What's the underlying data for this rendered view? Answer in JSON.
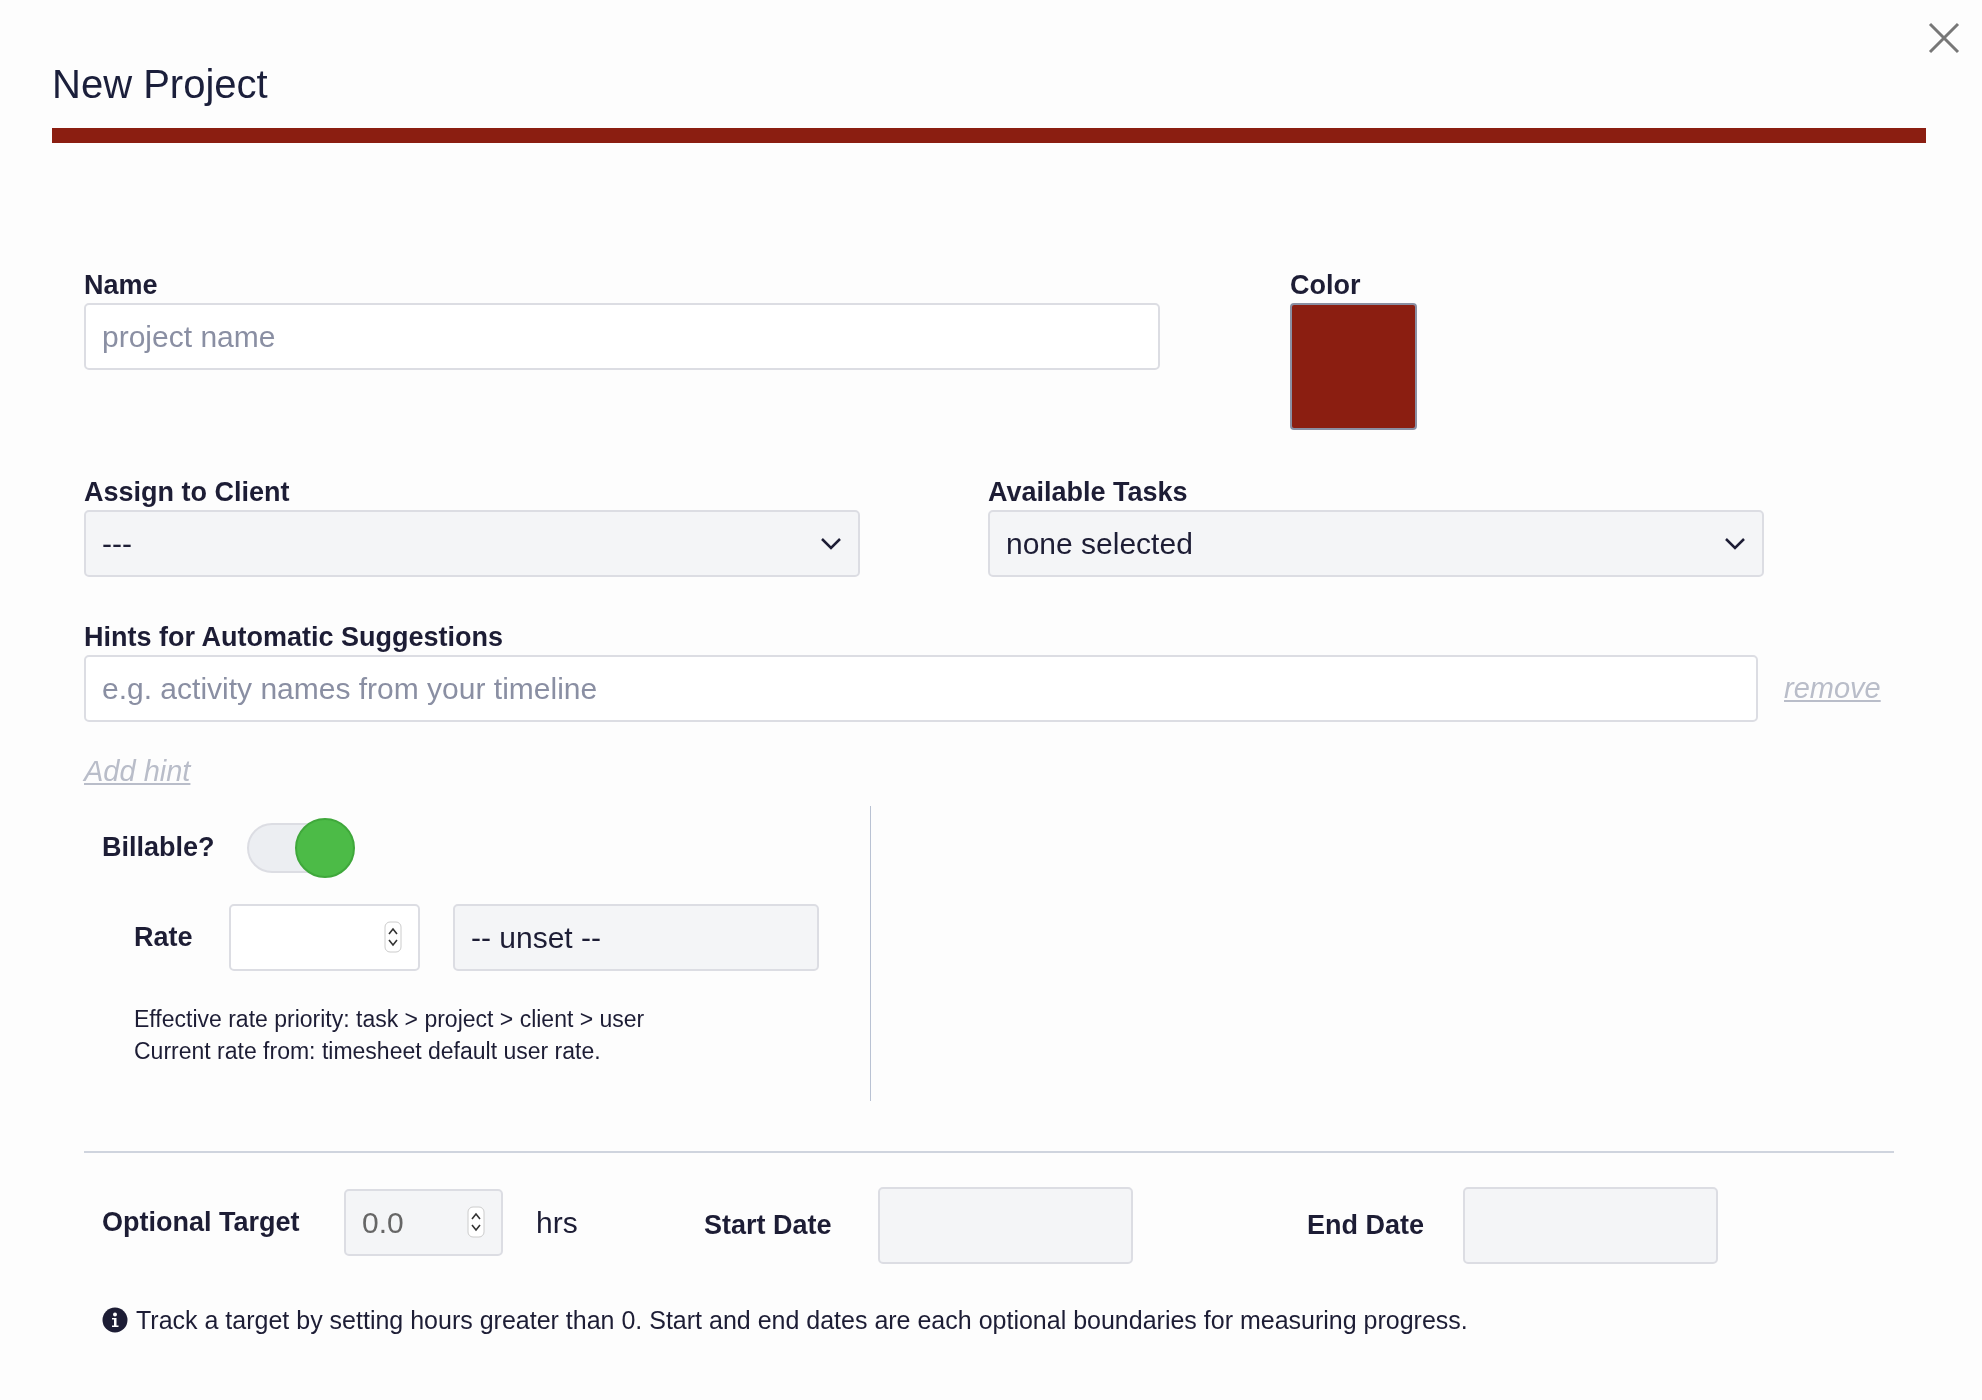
{
  "dialog": {
    "title": "New Project"
  },
  "name_field": {
    "label": "Name",
    "placeholder": "project name"
  },
  "color_field": {
    "label": "Color",
    "color": "#8b1e11"
  },
  "client_select": {
    "label": "Assign to Client",
    "value": "---"
  },
  "tasks_select": {
    "label": "Available Tasks",
    "value": "none selected"
  },
  "hints": {
    "label": "Hints for Automatic Suggestions",
    "placeholder": "e.g. activity names from your timeline",
    "remove_link": "remove",
    "add_link": "Add hint"
  },
  "billable": {
    "label": "Billable?",
    "on": true
  },
  "rate": {
    "label": "Rate",
    "unit_select": "-- unset --",
    "help_lines": [
      "Effective rate priority: task > project > client > user",
      "Current rate from: timesheet default user rate."
    ]
  },
  "target": {
    "label": "Optional Target",
    "value": "0.0",
    "unit": "hrs",
    "start_label": "Start Date",
    "end_label": "End Date",
    "info": "Track a target by setting hours greater than 0. Start and end dates are each optional boundaries for measuring progress."
  }
}
